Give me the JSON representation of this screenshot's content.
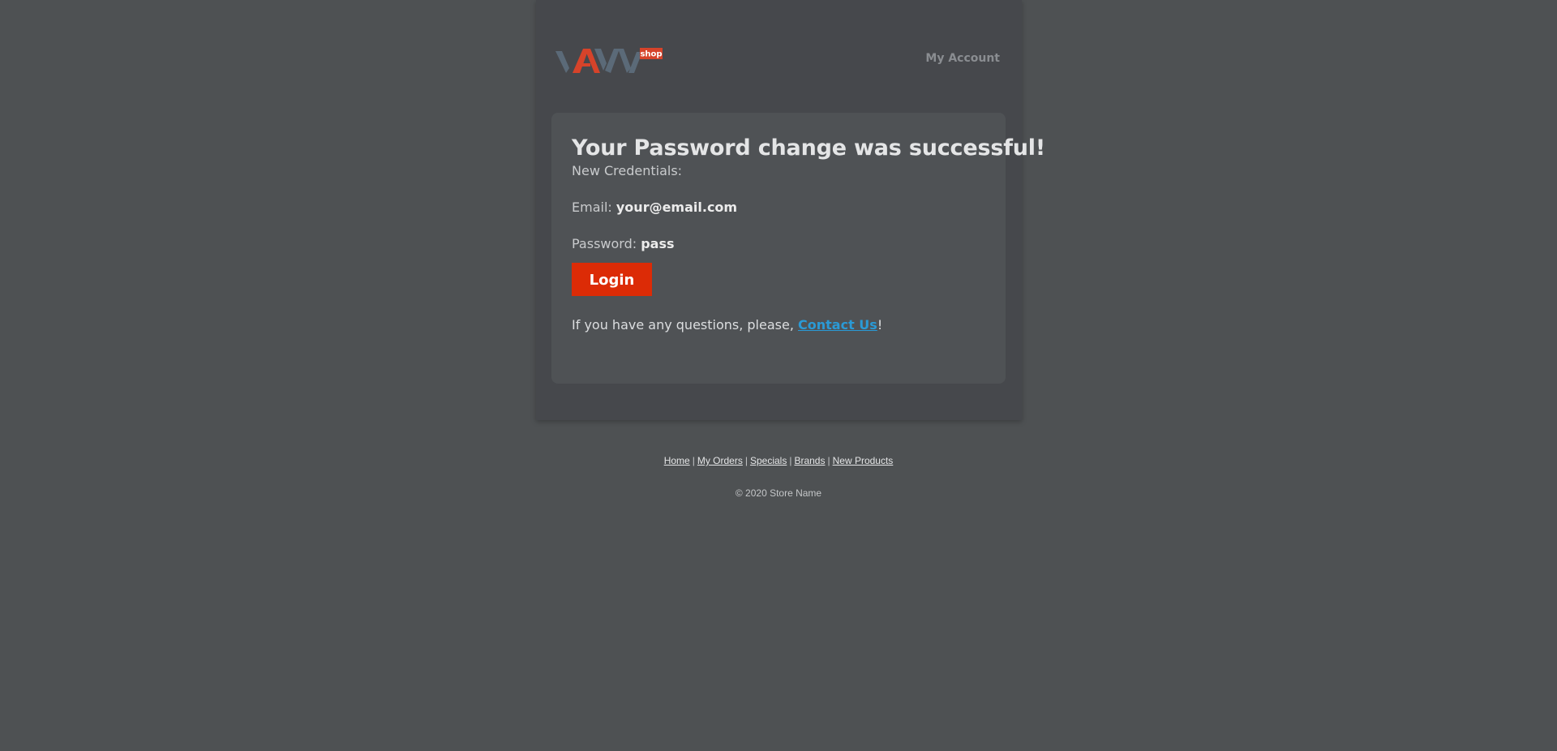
{
  "header": {
    "logo_badge": "shop",
    "my_account_label": "My Account"
  },
  "card": {
    "title": "Your Password change was successful!",
    "new_credentials_label": "New Credentials:",
    "email_label": "Email:",
    "email_value": "your@email.com",
    "password_label": "Password:",
    "password_value": "pass",
    "login_button_label": "Login",
    "questions_prefix": "If you have any questions, please,",
    "contact_link_label": "Contact Us",
    "questions_suffix": "!"
  },
  "footer": {
    "links": [
      "Home",
      "My Orders",
      "Specials",
      "Brands",
      "New Products"
    ],
    "separator": "|",
    "copyright": "© 2020 Store Name"
  },
  "colors": {
    "page_background": "#4e5153",
    "container_background": "#46484c",
    "card_background": "#4f5255",
    "accent_red": "#dc2b06",
    "link_blue": "#2a9ad6",
    "logo_slate": "#5b6a78"
  }
}
